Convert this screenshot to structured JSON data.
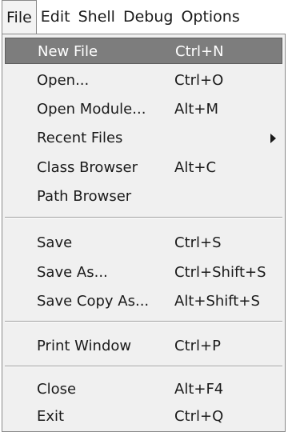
{
  "menubar": {
    "items": [
      {
        "label": "File"
      },
      {
        "label": "Edit"
      },
      {
        "label": "Shell"
      },
      {
        "label": "Debug"
      },
      {
        "label": "Options"
      }
    ]
  },
  "file_menu": {
    "items": [
      {
        "label": "New File",
        "shortcut": "Ctrl+N",
        "highlighted": true
      },
      {
        "label": "Open...",
        "shortcut": "Ctrl+O"
      },
      {
        "label": "Open Module...",
        "shortcut": "Alt+M"
      },
      {
        "label": "Recent Files",
        "shortcut": "",
        "submenu": true
      },
      {
        "label": "Class Browser",
        "shortcut": "Alt+C"
      },
      {
        "label": "Path Browser",
        "shortcut": ""
      },
      {
        "label": "Save",
        "shortcut": "Ctrl+S"
      },
      {
        "label": "Save As...",
        "shortcut": "Ctrl+Shift+S"
      },
      {
        "label": "Save Copy As...",
        "shortcut": "Alt+Shift+S"
      },
      {
        "label": "Print Window",
        "shortcut": "Ctrl+P"
      },
      {
        "label": "Close",
        "shortcut": "Alt+F4"
      },
      {
        "label": "Exit",
        "shortcut": "Ctrl+Q"
      }
    ]
  },
  "colors": {
    "highlight_bg": "#7d7d7d",
    "menu_bg": "#f0f0f0",
    "text": "#1a1a1a"
  }
}
